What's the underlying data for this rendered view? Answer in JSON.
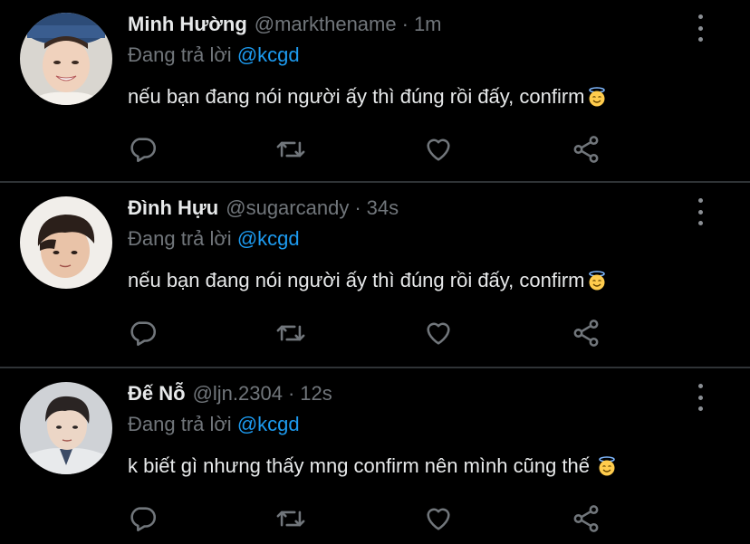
{
  "tweets": [
    {
      "name": "Minh Hường",
      "handle": "@markthename",
      "separator": "·",
      "time": "1m",
      "reply_prefix": "Đang trả lời",
      "reply_to": "@kcgd",
      "text": "nếu bạn đang nói người ấy thì đúng rồi đấy, confirm",
      "emoji": "smiling-face-with-halo"
    },
    {
      "name": "Đình Hựu",
      "handle": "@sugarcandy",
      "separator": "·",
      "time": "34s",
      "reply_prefix": "Đang trả lời",
      "reply_to": "@kcgd",
      "text": "nếu bạn đang nói người ấy thì đúng rồi đấy, confirm",
      "emoji": "smiling-face-with-halo"
    },
    {
      "name": "Đế Nỗ",
      "handle": "@ljn.2304",
      "separator": "·",
      "time": "12s",
      "reply_prefix": "Đang trả lời",
      "reply_to": "@kcgd",
      "text": "k biết gì nhưng thấy mng confirm nên mình cũng thế",
      "emoji": "smiling-face-with-halo"
    }
  ],
  "icons": {
    "reply": "reply-icon",
    "retweet": "retweet-icon",
    "like": "heart-icon",
    "share": "share-icon",
    "more": "more-vertical-icon"
  },
  "colors": {
    "background": "#000000",
    "text": "#e7e9ea",
    "muted": "#71767b",
    "link": "#1d9bf0",
    "divider": "#2f3336"
  }
}
